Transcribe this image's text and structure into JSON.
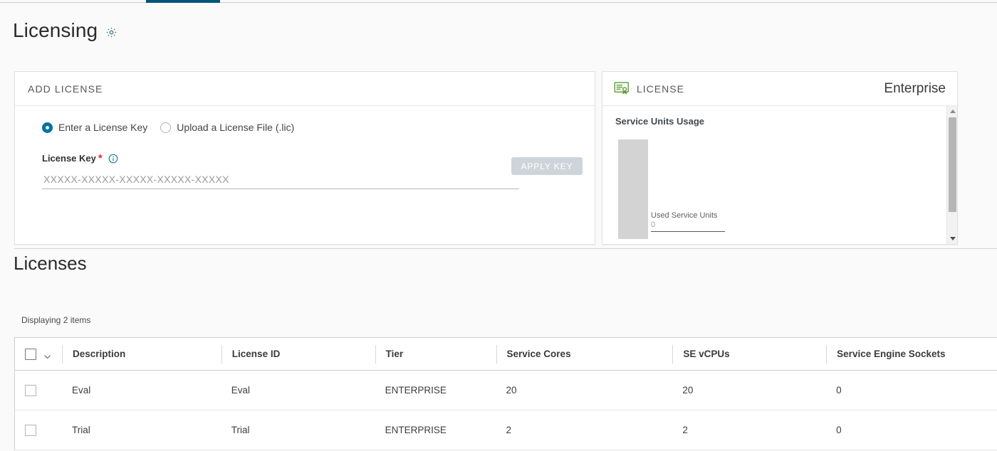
{
  "page": {
    "title": "Licensing",
    "settings_icon": "gear-icon",
    "section_title": "Licenses"
  },
  "add_license_card": {
    "header": "ADD LICENSE",
    "radio_options": [
      {
        "label": "Enter a License Key",
        "selected": true
      },
      {
        "label": "Upload a License File (.lic)",
        "selected": false
      }
    ],
    "field": {
      "label": "License Key",
      "required_marker": "*",
      "info_icon": "info-circle-icon",
      "value": "",
      "placeholder": "XXXXX-XXXXX-XXXXX-XXXXX-XXXXX"
    },
    "apply_button": {
      "label": "APPLY KEY",
      "enabled": false,
      "bg_color": "#cdd5da",
      "text_color": "#ffffff"
    }
  },
  "license_card": {
    "icon": "license-certificate-icon",
    "icon_color": "#5a9a32",
    "label": "LICENSE",
    "tier": "Enterprise",
    "usage_title": "Service Units Usage",
    "annotation": {
      "name": "Used Service Units",
      "value": "0"
    },
    "scrollbar": {
      "up_arrow": "chevron-up-icon",
      "down_arrow": "chevron-down-icon"
    }
  },
  "chart_data": {
    "type": "bar",
    "title": "Service Units Usage",
    "categories": [
      "Used Service Units"
    ],
    "values": [
      0
    ],
    "bar_color": "#d3d3d3",
    "annotations": [
      {
        "label": "Used Service Units",
        "value": 0
      }
    ],
    "xlabel": "",
    "ylabel": "",
    "legend": "none",
    "grid": false
  },
  "licenses_table": {
    "displaying": "Displaying 2 items",
    "select_all_checkbox": "unchecked",
    "select_all_chevron": "chevron-down-icon",
    "columns": [
      "Description",
      "License ID",
      "Tier",
      "Service Cores",
      "SE vCPUs",
      "Service Engine Sockets"
    ],
    "rows": [
      {
        "description": "Eval",
        "license_id": "Eval",
        "tier": "ENTERPRISE",
        "service_cores": "20",
        "se_vcpus": "20",
        "service_engine_sockets": "0"
      },
      {
        "description": "Trial",
        "license_id": "Trial",
        "tier": "ENTERPRISE",
        "service_cores": "2",
        "se_vcpus": "2",
        "service_engine_sockets": "0"
      }
    ]
  },
  "theme": {
    "accent": "#0072a3",
    "tab_indicator": "#00567a",
    "required_star": "#e02b27",
    "page_bg": "#fafafa",
    "card_bg": "#ffffff"
  }
}
